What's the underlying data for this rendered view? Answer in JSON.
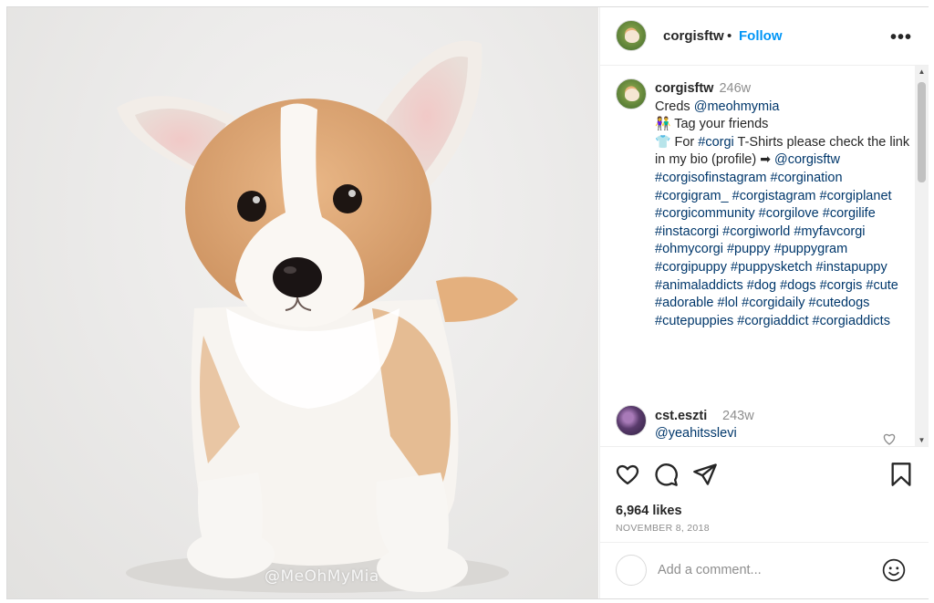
{
  "post": {
    "author": "corgisftw",
    "follow_label": "Follow",
    "separator": "•",
    "more_icon": "more-icon",
    "watermark": "@MeOhMyMia"
  },
  "caption": {
    "user": "corgisftw",
    "time": "246w",
    "line1_prefix": "Creds ",
    "line1_mention": "@meohmymia",
    "tag_text": "Tag your friends",
    "for_prefix": "For ",
    "for_hashtag": "#corgi",
    "for_text": " T-Shirts please check the link in my bio (profile) ",
    "arrow": "➡",
    "for_mention": "@corgisftw",
    "hashtags": [
      "#corgisofinstagram",
      "#corgination",
      "#corgigram_",
      "#corgistagram",
      "#corgiplanet",
      "#corgicommunity",
      "#corgilove",
      "#corgilife",
      "#instacorgi",
      "#corgiworld",
      "#myfavcorgi",
      "#ohmycorgi",
      "#puppy",
      "#puppygram",
      "#corgipuppy",
      "#puppysketch",
      "#instapuppy",
      "#animaladdicts",
      "#dog",
      "#dogs",
      "#corgis",
      "#cute",
      "#adorable",
      "#lol",
      "#corgidaily",
      "#cutedogs",
      "#cutepuppies",
      "#corgiaddict",
      "#corgiaddicts"
    ]
  },
  "reply": {
    "user": "cst.eszti",
    "time": "243w",
    "text": "@yeahitsslevi"
  },
  "stats": {
    "likes": "6,964 likes",
    "date": "NOVEMBER 8, 2018"
  },
  "comment_box": {
    "placeholder": "Add a comment..."
  },
  "colors": {
    "link": "#00376b",
    "follow": "#0095f6",
    "muted": "#8e8e8e"
  }
}
